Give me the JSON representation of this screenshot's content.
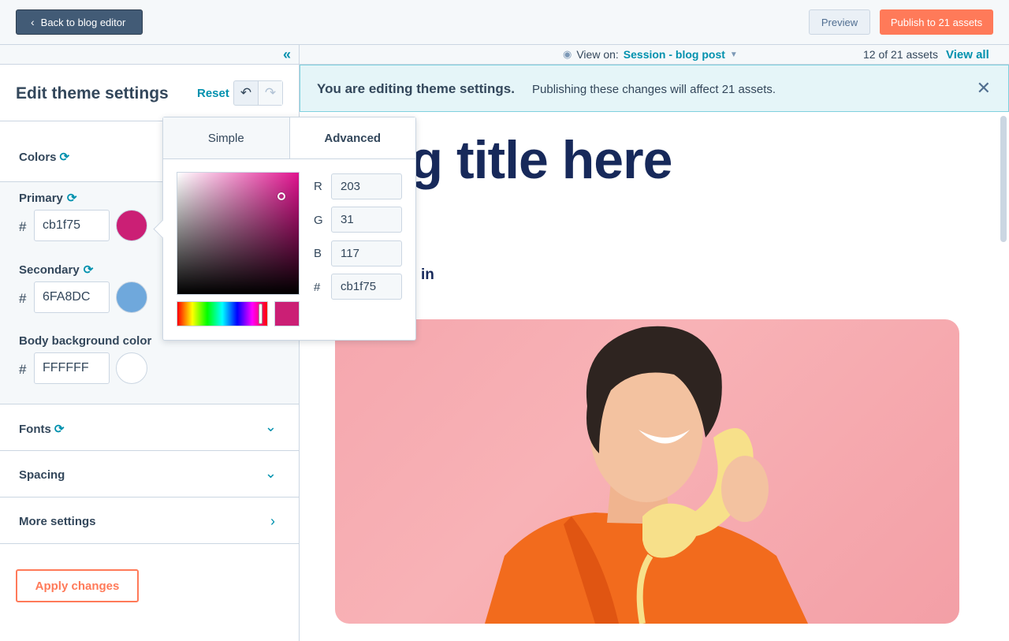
{
  "topbar": {
    "back_label": "Back to blog editor",
    "preview_label": "Preview",
    "publish_label": "Publish to 21 assets"
  },
  "sidebar": {
    "title": "Edit theme settings",
    "reset_label": "Reset",
    "colors": {
      "label": "Colors",
      "fields": [
        {
          "label": "Primary",
          "hash": "#",
          "value": "cb1f75",
          "swatch": "#cb1f75"
        },
        {
          "label": "Secondary",
          "hash": "#",
          "value": "6FA8DC",
          "swatch": "#6fa8dc"
        },
        {
          "label": "Body background color",
          "hash": "#",
          "value": "FFFFFF",
          "swatch": "#ffffff"
        }
      ]
    },
    "sections": [
      {
        "label": "Fonts"
      },
      {
        "label": "Spacing"
      },
      {
        "label": "More settings"
      }
    ],
    "apply_label": "Apply changes"
  },
  "viewbar": {
    "view_on_label": "View on:",
    "view_session": "Session - blog post",
    "asset_count": "12 of 21 assets",
    "view_all": "View all"
  },
  "banner": {
    "title": "You are editing theme settings.",
    "text": "Publishing these changes will affect 21 assets."
  },
  "preview": {
    "blog_title": "og title here",
    "social_icon": "in"
  },
  "picker": {
    "tab_simple": "Simple",
    "tab_advanced": "Advanced",
    "r_label": "R",
    "r_value": "203",
    "g_label": "G",
    "g_value": "31",
    "b_label": "B",
    "b_value": "117",
    "hex_label": "#",
    "hex_value": "cb1f75"
  },
  "colors": {
    "accent": "#0091ae",
    "publish": "#ff7a59",
    "nav_dark": "#425b76"
  }
}
